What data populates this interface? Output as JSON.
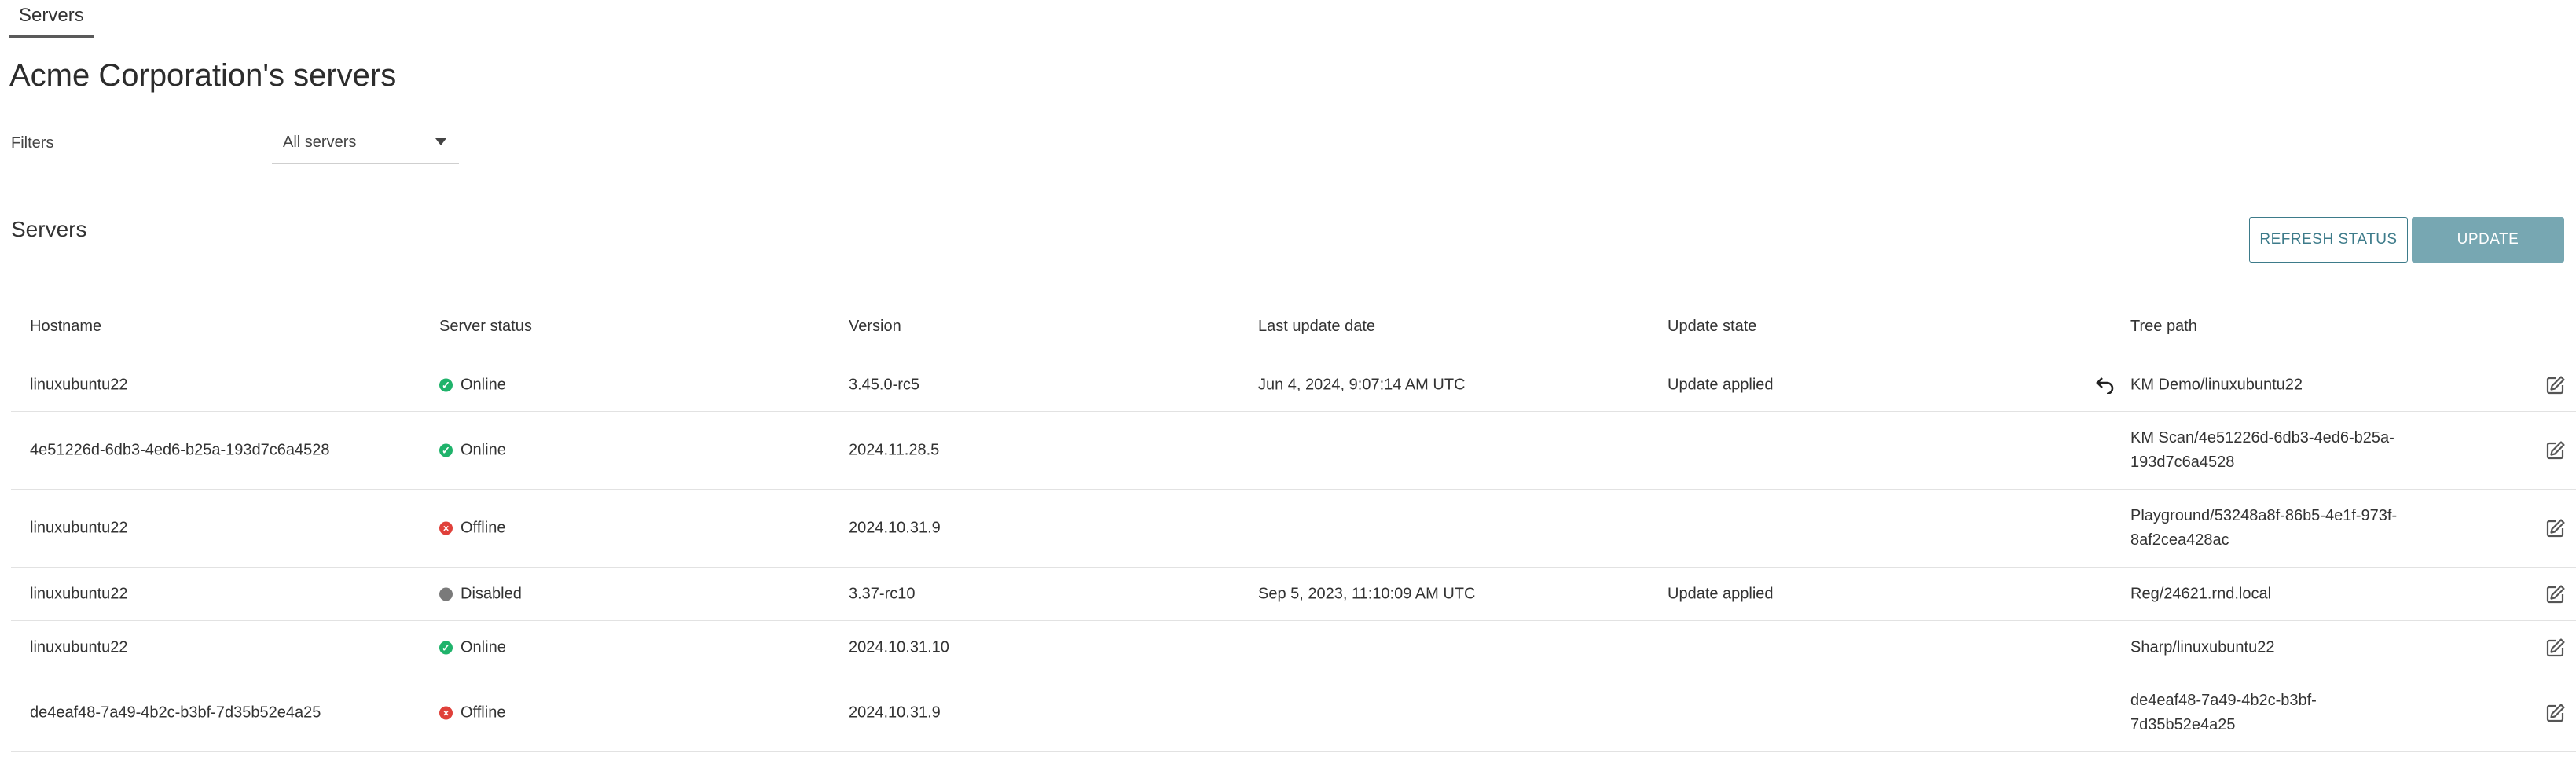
{
  "tabs": [
    {
      "label": "Servers",
      "active": true
    }
  ],
  "page": {
    "title": "Acme Corporation's servers"
  },
  "filters": {
    "label": "Filters",
    "selected": "All servers"
  },
  "section": {
    "title": "Servers"
  },
  "buttons": {
    "refresh": "REFRESH STATUS",
    "update": "UPDATE"
  },
  "colors": {
    "accent": "#3d7b8a",
    "update_button": "#77a7b2",
    "online": "#1fb36b",
    "offline": "#e0403a",
    "disabled": "#7a7a7a"
  },
  "table": {
    "columns": [
      "Hostname",
      "Server status",
      "Version",
      "Last update date",
      "Update state",
      "Tree path"
    ],
    "rows": [
      {
        "hostname": "linuxubuntu22",
        "status": "Online",
        "status_icon": "check-circle-icon",
        "version": "3.45.0-rc5",
        "last_update": "Jun 4, 2024, 9:07:14 AM UTC",
        "update_state": "Update applied",
        "undo_icon": "undo-icon",
        "tree_path": [
          "KM Demo/linuxubuntu22"
        ]
      },
      {
        "hostname": "4e51226d-6db3-4ed6-b25a-193d7c6a4528",
        "status": "Online",
        "status_icon": "check-circle-icon",
        "version": "2024.11.28.5",
        "last_update": "",
        "update_state": "",
        "tree_path": [
          "KM Scan/4e51226d-6db3-4ed6-b25a-",
          "193d7c6a4528"
        ]
      },
      {
        "hostname": "linuxubuntu22",
        "status": "Offline",
        "status_icon": "x-circle-icon",
        "version": "2024.10.31.9",
        "last_update": "",
        "update_state": "",
        "tree_path": [
          "Playground/53248a8f-86b5-4e1f-973f-",
          "8af2cea428ac"
        ]
      },
      {
        "hostname": "linuxubuntu22",
        "status": "Disabled",
        "status_icon": "disabled-dot-icon",
        "version": "3.37-rc10",
        "last_update": "Sep 5, 2023, 11:10:09 AM UTC",
        "update_state": "Update applied",
        "tree_path": [
          "Reg/24621.rnd.local"
        ]
      },
      {
        "hostname": "linuxubuntu22",
        "status": "Online",
        "status_icon": "check-circle-icon",
        "version": "2024.10.31.10",
        "last_update": "",
        "update_state": "",
        "tree_path": [
          "Sharp/linuxubuntu22"
        ]
      },
      {
        "hostname": "de4eaf48-7a49-4b2c-b3bf-7d35b52e4a25",
        "status": "Offline",
        "status_icon": "x-circle-icon",
        "version": "2024.10.31.9",
        "last_update": "",
        "update_state": "",
        "tree_path": [
          "de4eaf48-7a49-4b2c-b3bf-",
          "7d35b52e4a25"
        ]
      }
    ]
  }
}
